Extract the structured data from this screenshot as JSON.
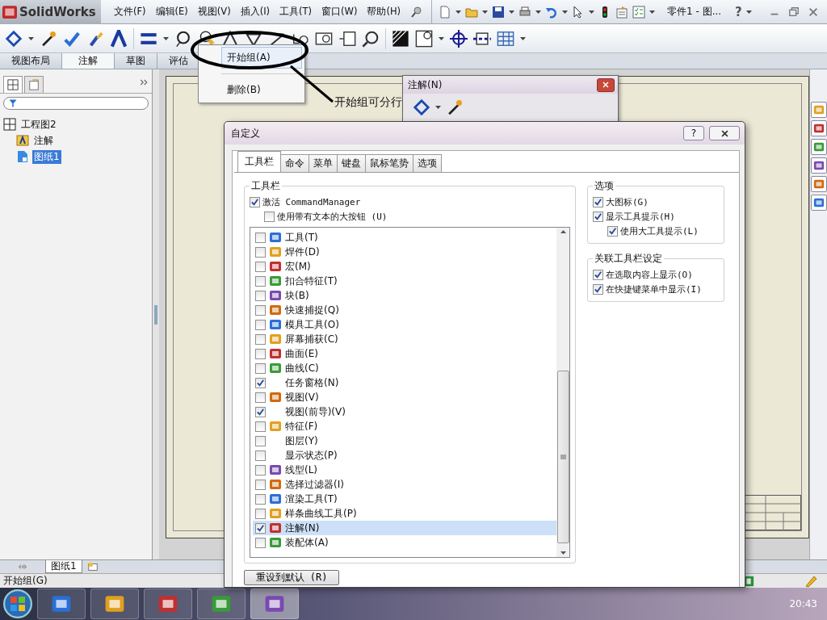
{
  "app": {
    "logo": "SolidWorks",
    "menus": [
      "文件(F)",
      "编辑(E)",
      "视图(V)",
      "插入(I)",
      "工具(T)",
      "窗口(W)",
      "帮助(H)"
    ],
    "document_title": "零件1 - 图...",
    "help": "?"
  },
  "command_tabs": [
    {
      "label": "视图布局",
      "selected": false
    },
    {
      "label": "注解",
      "selected": true
    },
    {
      "label": "草图",
      "selected": false
    },
    {
      "label": "评估",
      "selected": false
    }
  ],
  "context_menu": {
    "items": [
      {
        "label": "开始组(A)",
        "selected": true
      },
      {
        "label": "删除(B)",
        "selected": false
      }
    ]
  },
  "callout": {
    "text": "开始组可分行"
  },
  "feature_tree": {
    "root": {
      "label": "工程图2",
      "children": [
        {
          "label": "注解",
          "selected": false
        },
        {
          "label": "图纸1",
          "selected": true
        }
      ]
    }
  },
  "floating_toolbar": {
    "title": "注解(N)"
  },
  "dialog": {
    "title": "自定义",
    "help": "?",
    "tabs": [
      {
        "label": "工具栏",
        "selected": true
      },
      {
        "label": "命令",
        "selected": false
      },
      {
        "label": "菜单",
        "selected": false
      },
      {
        "label": "键盘",
        "selected": false
      },
      {
        "label": "鼠标笔势",
        "selected": false
      },
      {
        "label": "选项",
        "selected": false
      }
    ],
    "toolbar_group": {
      "title": "工具栏",
      "command_manager": {
        "label": "激活 CommandManager",
        "checked": true,
        "children": [
          {
            "label": "使用带有文本的大按钮 (U)",
            "checked": false
          }
        ]
      },
      "toolbars": [
        {
          "label": "工具(T)",
          "checked": false,
          "has_icon": true,
          "selected": false
        },
        {
          "label": "焊件(D)",
          "checked": false,
          "has_icon": true,
          "selected": false
        },
        {
          "label": "宏(M)",
          "checked": false,
          "has_icon": true,
          "selected": false
        },
        {
          "label": "扣合特征(T)",
          "checked": false,
          "has_icon": true,
          "selected": false
        },
        {
          "label": "块(B)",
          "checked": false,
          "has_icon": true,
          "selected": false
        },
        {
          "label": "快速捕捉(Q)",
          "checked": false,
          "has_icon": true,
          "selected": false
        },
        {
          "label": "模具工具(O)",
          "checked": false,
          "has_icon": true,
          "selected": false
        },
        {
          "label": "屏幕捕获(C)",
          "checked": false,
          "has_icon": true,
          "selected": false
        },
        {
          "label": "曲面(E)",
          "checked": false,
          "has_icon": true,
          "selected": false
        },
        {
          "label": "曲线(C)",
          "checked": false,
          "has_icon": true,
          "selected": false
        },
        {
          "label": "任务窗格(N)",
          "checked": true,
          "has_icon": false,
          "selected": false
        },
        {
          "label": "视图(V)",
          "checked": false,
          "has_icon": true,
          "selected": false
        },
        {
          "label": "视图(前导)(V)",
          "checked": true,
          "has_icon": false,
          "selected": false
        },
        {
          "label": "特征(F)",
          "checked": false,
          "has_icon": true,
          "selected": false
        },
        {
          "label": "图层(Y)",
          "checked": false,
          "has_icon": false,
          "selected": false
        },
        {
          "label": "显示状态(P)",
          "checked": false,
          "has_icon": false,
          "selected": false
        },
        {
          "label": "线型(L)",
          "checked": false,
          "has_icon": true,
          "selected": false
        },
        {
          "label": "选择过滤器(I)",
          "checked": false,
          "has_icon": true,
          "selected": false
        },
        {
          "label": "渲染工具(T)",
          "checked": false,
          "has_icon": true,
          "selected": false
        },
        {
          "label": "样条曲线工具(P)",
          "checked": false,
          "has_icon": true,
          "selected": false
        },
        {
          "label": "注解(N)",
          "checked": true,
          "has_icon": true,
          "selected": true
        },
        {
          "label": "装配体(A)",
          "checked": false,
          "has_icon": true,
          "selected": false
        }
      ]
    },
    "options_group": {
      "title": "选项",
      "options": [
        {
          "label": "大图标(G)",
          "checked": true
        },
        {
          "label": "显示工具提示(H)",
          "checked": true,
          "children": [
            {
              "label": "使用大工具提示(L)",
              "checked": true
            }
          ]
        }
      ]
    },
    "context_group": {
      "title": "关联工具栏设定",
      "options": [
        {
          "label": "在选取内容上显示(O)",
          "checked": true
        },
        {
          "label": "在快捷键菜单中显示(I)",
          "checked": true
        }
      ]
    },
    "reset_button": "重设到默认 (R)"
  },
  "sheet_tabs": [
    {
      "label": "图纸1",
      "selected": true
    }
  ],
  "status_bar": {
    "text": "开始组(G)"
  },
  "taskbar": {
    "clock": "20:43"
  }
}
